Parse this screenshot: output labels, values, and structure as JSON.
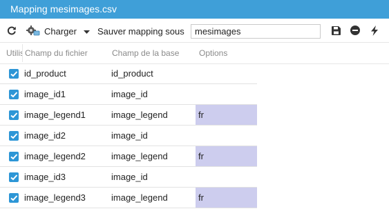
{
  "window": {
    "title": "Mapping mesimages.csv"
  },
  "toolbar": {
    "refresh_icon": "refresh-icon",
    "load_label": "Charger",
    "load_icon": "load-icon",
    "dropdown_icon": "chevron-down-icon",
    "save_as_label": "Sauver mapping sous",
    "mapping_name_value": "mesimages",
    "save_icon": "save-icon",
    "remove_icon": "remove-icon",
    "run_icon": "bolt-icon"
  },
  "grid": {
    "columns": {
      "use": "Utiliser",
      "file_field": "Champ du fichier",
      "db_field": "Champ de la base",
      "options": "Options"
    },
    "rows": [
      {
        "checked": true,
        "file_field": "id_product",
        "db_field": "id_product",
        "options": ""
      },
      {
        "checked": true,
        "file_field": "image_id1",
        "db_field": "image_id",
        "options": ""
      },
      {
        "checked": true,
        "file_field": "image_legend1",
        "db_field": "image_legend",
        "options": "fr"
      },
      {
        "checked": true,
        "file_field": "image_id2",
        "db_field": "image_id",
        "options": ""
      },
      {
        "checked": true,
        "file_field": "image_legend2",
        "db_field": "image_legend",
        "options": "fr"
      },
      {
        "checked": true,
        "file_field": "image_id3",
        "db_field": "image_id",
        "options": ""
      },
      {
        "checked": true,
        "file_field": "image_legend3",
        "db_field": "image_legend",
        "options": "fr"
      }
    ]
  },
  "colors": {
    "title_bar": "#3f9fd8",
    "checkbox": "#2d96d6",
    "option_cell": "#cdcdee"
  }
}
